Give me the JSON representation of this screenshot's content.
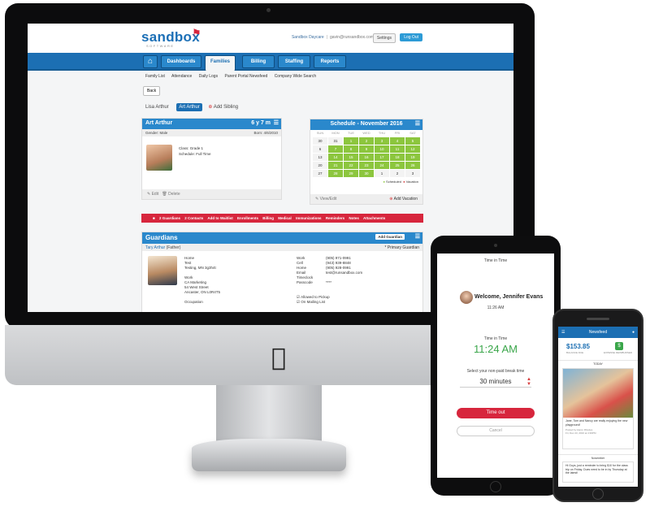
{
  "web": {
    "logo": "sandbox",
    "logo_sub": "SOFTWARE",
    "header": {
      "org": "Sandbox Daycare",
      "email": "gavin@runsandbox.com",
      "settings": "Settings",
      "logout": "Log Out"
    },
    "nav": {
      "home_icon": "home-icon",
      "tabs": [
        "Dashboards",
        "Families",
        "Billing",
        "Staffing",
        "Reports"
      ],
      "active": "Families"
    },
    "subnav": [
      "Family List",
      "Attendance",
      "Daily Logs",
      "Parent Portal Newsfeed",
      "Company Wide Search"
    ],
    "back": "Back",
    "siblings": {
      "other": "Lisa Arthur",
      "current": "Art Arthur",
      "add": "Add Sibling"
    },
    "child": {
      "name": "Art Arthur",
      "age": "6 y 7 m",
      "gender": "Gender: Male",
      "born": "Born: 4/6/2010",
      "class": "Class: Grade 1",
      "schedule": "Schedule: Full Time",
      "edit": "Edit",
      "delete": "Delete"
    },
    "schedule": {
      "title": "Schedule - November 2016",
      "days": [
        "SUN",
        "MON",
        "TUE",
        "WED",
        "THU",
        "FRI",
        "SAT"
      ],
      "cells": [
        "30",
        "31",
        "1",
        "2",
        "3",
        "4",
        "5",
        "6",
        "7",
        "8",
        "9",
        "10",
        "11",
        "12",
        "13",
        "14",
        "15",
        "16",
        "17",
        "18",
        "19",
        "20",
        "21",
        "22",
        "23",
        "24",
        "25",
        "26",
        "27",
        "28",
        "29",
        "30",
        "1",
        "2",
        "3"
      ],
      "scheduled_note": "Scheduled",
      "vacation_note": "Vacation",
      "view_edit": "View/Edit",
      "add_vacation": "Add Vacation"
    },
    "redbar": [
      "2 Guardians",
      "2 Contacts",
      "Add to Waitlist",
      "Enrollments",
      "Billing",
      "Medical",
      "Immunizations",
      "Reminders",
      "Notes",
      "Attachments"
    ],
    "guardians": {
      "title": "Guardians",
      "add": "Add Guardian",
      "name": "Tary Arthur",
      "relation": "(Father)",
      "primary": "* Primary Guardian",
      "address": [
        "Home",
        "Test",
        "Testing, MN 3g3h4t",
        "",
        "Work",
        "CA Marketing",
        "54 West Street",
        "Ancaster, ON L0R4T5",
        "",
        "Occupation"
      ],
      "contact_labels": [
        "Work",
        "Cell",
        "Home",
        "Email",
        "Timeclock",
        "Passcode"
      ],
      "contact_values": [
        "(905) 971-0991",
        "(943) 939-8848",
        "(905) 928-0991",
        "test@runsandbox.com",
        "",
        "****"
      ],
      "allowed_pickup": "Allowed to Pickup",
      "mailing_list": "On Mailing List"
    }
  },
  "tablet": {
    "time_label": "Time in Time",
    "welcome": "Welcome, Jennifer Evans",
    "welcome_time": "11:26 AM",
    "time_in_label": "Time in Time",
    "time_in": "11:24 AM",
    "break_label": "Select your non-paid break time",
    "break_value": "30 minutes",
    "timeout": "Time out",
    "cancel": "Cancel"
  },
  "phone": {
    "nav_title": "Newsfeed",
    "balance": "$153.85",
    "balance_label": "BALANCE DUE",
    "money_icon": "dollar-icon",
    "money_label": "EXPENSE REIMBURSED",
    "today": "TODAY",
    "post_text": "Jane, Tom and Nancy are really enjoying the new playground!",
    "post_meta": "Posted by Aaron Rhodes",
    "post_date": "Fri, Dec 23, 2016 at 4:30PM",
    "month": "November",
    "post2": "Hi Guys, just a reminder to bring $10 for the class trip on Friday. Dues need to be in by Thursday at the latest!"
  }
}
